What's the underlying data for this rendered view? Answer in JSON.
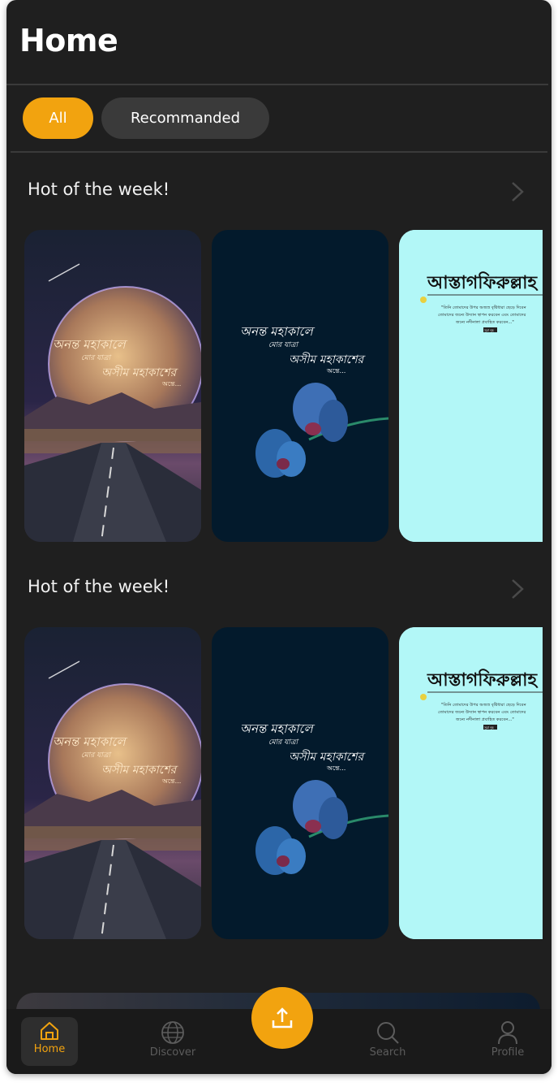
{
  "header": {
    "title": "Home"
  },
  "filters": [
    {
      "label": "All",
      "active": true
    },
    {
      "label": "Recommanded",
      "active": false
    }
  ],
  "sections": [
    {
      "title": "Hot of the week!",
      "cards": [
        {
          "line1": "অনন্ত মহাকালে",
          "line2": "মোর যাত্রা",
          "line3": "অসীম মহাকাশের",
          "line4": "অন্তে..."
        },
        {
          "line1": "অনন্ত মহাকালে",
          "line2": "মোর যাত্রা",
          "line3": "অসীম মহাকাশের",
          "line4": "অন্তে..."
        },
        {
          "heading": "আস্তাগফিরুল্লাহ",
          "body1": "\"তিনি তোমাদের উপর অজস্র বৃষ্টিধারা ছেড়ে দিবেন",
          "body2": "তোমাদের জন্যে উদ্যান স্থাপন করবেন এবং তোমাদের",
          "body3": "জন্যে নদীনালা প্রবাহিত করবেন...\"",
          "tag": "সূরা নূহ"
        }
      ]
    },
    {
      "title": "Hot of the week!",
      "cards": [
        {
          "line1": "অনন্ত মহাকালে",
          "line2": "মোর যাত্রা",
          "line3": "অসীম মহাকাশের",
          "line4": "অন্তে..."
        },
        {
          "line1": "অনন্ত মহাকালে",
          "line2": "মোর যাত্রা",
          "line3": "অসীম মহাকাশের",
          "line4": "অন্তে..."
        },
        {
          "heading": "আস্তাগফিরুল্লাহ",
          "body1": "\"তিনি তোমাদের উপর অজস্র বৃষ্টিধারা ছেড়ে দিবেন",
          "body2": "তোমাদের জন্যে উদ্যান স্থাপন করবেন এবং তোমাদের",
          "body3": "জন্যে নদীনালা প্রবাহিত করবেন...\"",
          "tag": "সূরা নূহ"
        }
      ]
    }
  ],
  "nav": {
    "home": "Home",
    "discover": "Discover",
    "search": "Search",
    "profile": "Profile"
  },
  "colors": {
    "accent": "#f2a30f",
    "background": "#1f1f1f",
    "chip_inactive": "#3a3a3a",
    "nav_inactive": "#5c5c5c"
  },
  "icons": {
    "chevron": "chevron-right-icon",
    "upload": "upload-icon",
    "home": "home-icon",
    "discover": "globe-icon",
    "search": "search-icon",
    "profile": "user-icon"
  }
}
